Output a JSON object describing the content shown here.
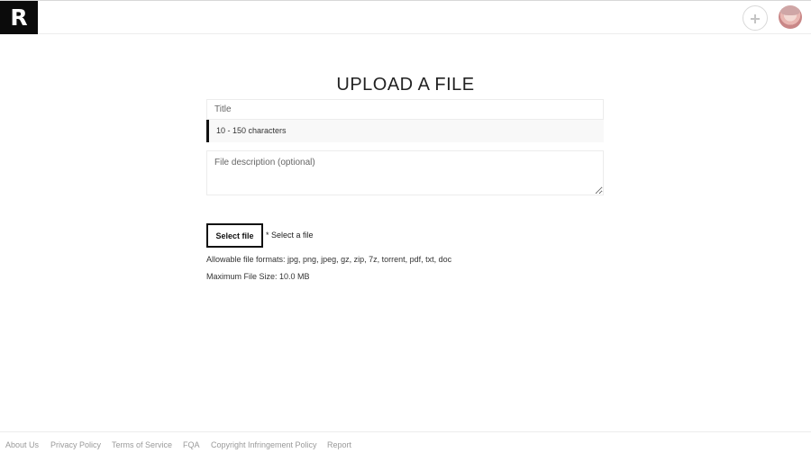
{
  "header": {
    "logo_text": "R",
    "add_icon": "plus-icon",
    "avatar": "user-avatar"
  },
  "main": {
    "title": "UPLOAD A FILE",
    "title_field": {
      "placeholder": "Title",
      "value": ""
    },
    "title_hint": "10 - 150 characters",
    "description_field": {
      "placeholder": "File description (optional)",
      "value": ""
    },
    "select_file_label": "Select file",
    "select_file_hint": "* Select a file",
    "allowable_formats": "Allowable file formats: jpg, png, jpeg, gz, zip, 7z, torrent, pdf, txt, doc",
    "max_file_size": "Maximum File Size: 10.0 MB"
  },
  "footer": {
    "links": [
      "About Us",
      "Privacy Policy",
      "Terms of Service",
      "FQA",
      "Copyright Infringement Policy",
      "Report"
    ]
  },
  "colors": {
    "logo_bg": "#0b0b0b",
    "accent_border": "#111111",
    "footer_link": "#9a9a9a"
  }
}
